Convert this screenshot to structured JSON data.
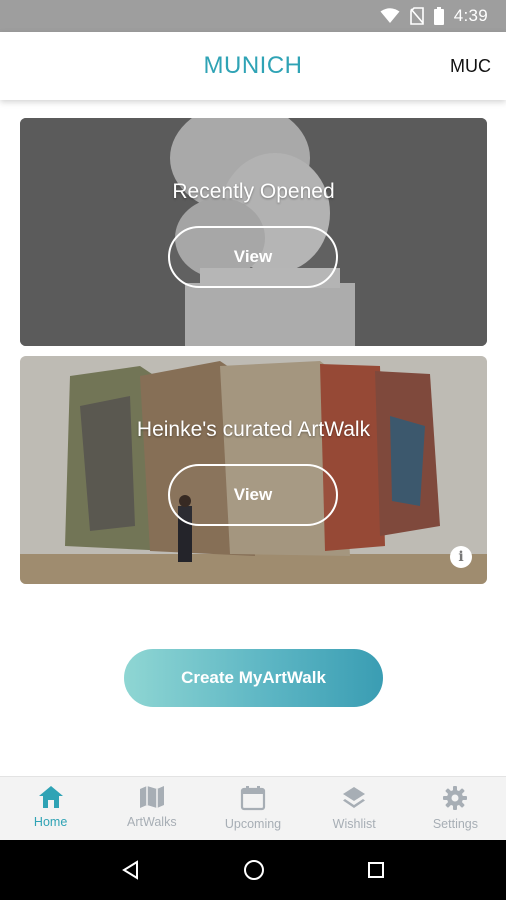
{
  "status_bar": {
    "time": "4:39",
    "icons": [
      "wifi-icon",
      "no-sim-icon",
      "battery-icon"
    ]
  },
  "header": {
    "title": "MUNICH",
    "city_code": "MUC"
  },
  "cards": [
    {
      "title": "Recently Opened",
      "button_label": "View"
    },
    {
      "title": "Heinke's curated ArtWalk",
      "button_label": "View",
      "info_label": "i"
    }
  ],
  "create_button": {
    "label": "Create MyArtWalk"
  },
  "bottom_nav": {
    "items": [
      {
        "label": "Home",
        "icon": "home-icon",
        "active": true
      },
      {
        "label": "ArtWalks",
        "icon": "map-icon",
        "active": false
      },
      {
        "label": "Upcoming",
        "icon": "calendar-icon",
        "active": false
      },
      {
        "label": "Wishlist",
        "icon": "layers-icon",
        "active": false
      },
      {
        "label": "Settings",
        "icon": "gear-icon",
        "active": false
      }
    ]
  },
  "system_nav": [
    "back-icon",
    "home-circle-icon",
    "recents-icon"
  ],
  "colors": {
    "accent": "#2fa3b5",
    "status_bar": "#9e9e9e",
    "nav_inactive": "#a7aeb5",
    "create_gradient_start": "#8fd6d3",
    "create_gradient_end": "#3a9db3"
  }
}
